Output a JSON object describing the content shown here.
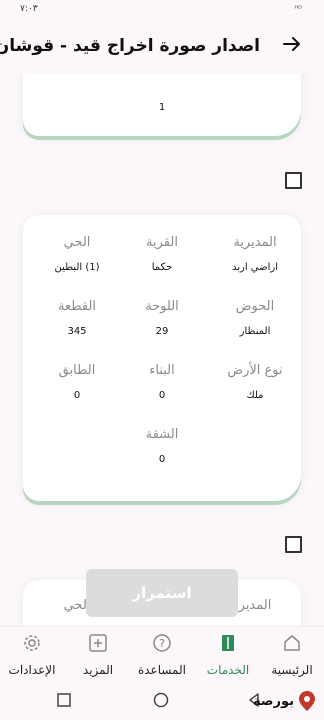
{
  "status_bar": {
    "time": "٧:٠٣",
    "signal": "ᴴᴰ"
  },
  "header": {
    "title": "اصدار صورة اخراج قيد - قوشان",
    "back_icon": "arrow-right-icon"
  },
  "top_card": {
    "value": "1"
  },
  "main_card": {
    "rows": [
      [
        {
          "label": "المديرية",
          "value": "اراضي اربد"
        },
        {
          "label": "القرية",
          "value": "حكما"
        },
        {
          "label": "الحي",
          "value": "(1) البطين"
        }
      ],
      [
        {
          "label": "الحوض",
          "value": "المنظار"
        },
        {
          "label": "اللوحة",
          "value": "29"
        },
        {
          "label": "القطعة",
          "value": "345"
        }
      ],
      [
        {
          "label": "نوع الأرض",
          "value": "ملك"
        },
        {
          "label": "البناء",
          "value": "0"
        },
        {
          "label": "الطابق",
          "value": "0"
        }
      ],
      [
        {
          "label": "الشقة",
          "value": "0"
        }
      ]
    ]
  },
  "bottom_card": {
    "label_right": "المدير",
    "label_left": "الحي"
  },
  "continue_button": {
    "label": "استمرار"
  },
  "nav": [
    {
      "label": "الرئيسية",
      "icon": "home-icon",
      "active": false
    },
    {
      "label": "الخدمات",
      "icon": "services-icon",
      "active": true
    },
    {
      "label": "المساعدة",
      "icon": "help-icon",
      "active": false
    },
    {
      "label": "المزيد",
      "icon": "plus-icon",
      "active": false
    },
    {
      "label": "الإعدادات",
      "icon": "gear-icon",
      "active": false
    }
  ],
  "watermark": {
    "text": "بورصة"
  },
  "colors": {
    "accent": "#2e8b57",
    "card_shadow": "#8cc8a0",
    "button_disabled": "#dcdcdc"
  }
}
